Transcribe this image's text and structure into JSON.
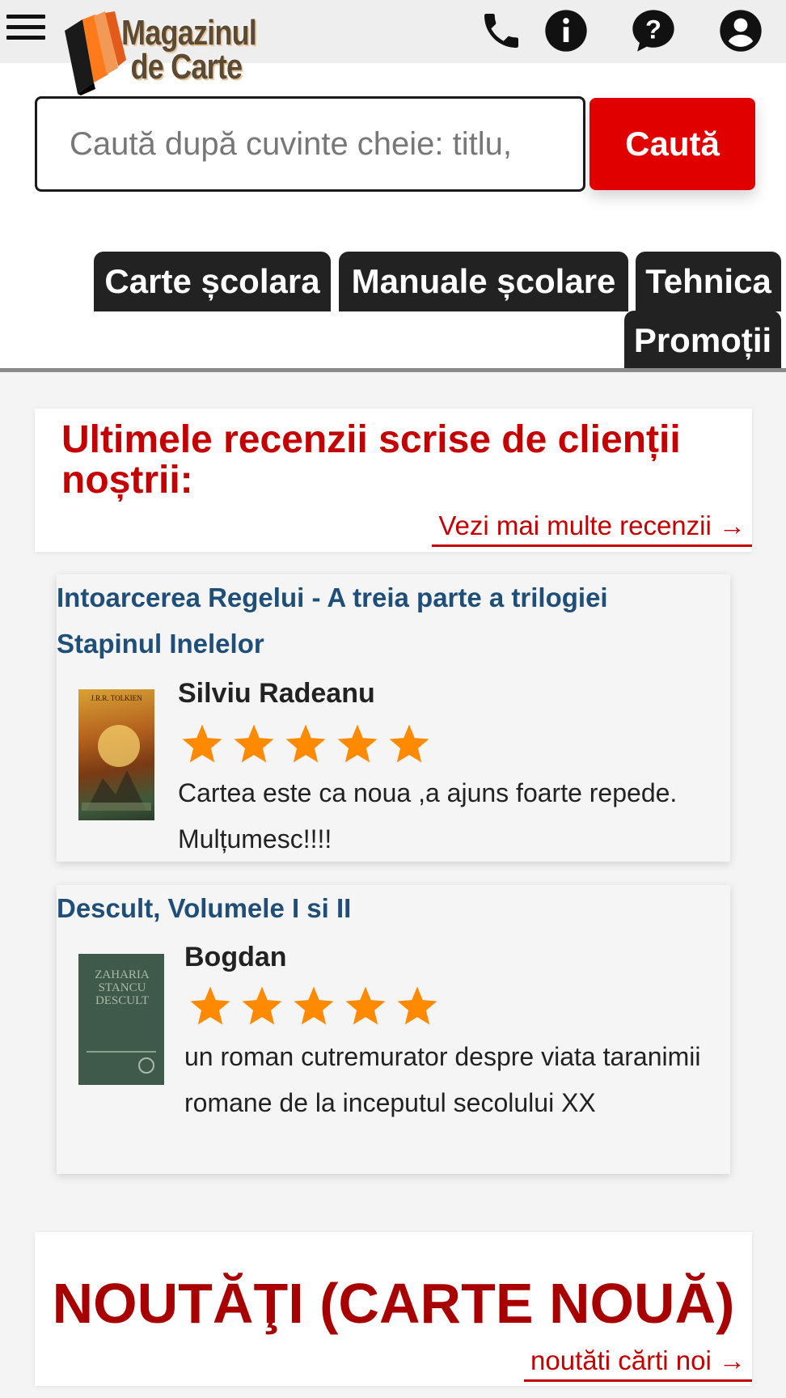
{
  "header": {
    "logo_line1": "Magazinul",
    "logo_line2": "de Carte",
    "icons": [
      "menu-icon",
      "phone-icon",
      "info-icon",
      "help-icon",
      "account-icon"
    ]
  },
  "search": {
    "placeholder": "Caută după cuvinte cheie: titlu,",
    "button_label": "Caută"
  },
  "categories": [
    {
      "label": "Carte școlara"
    },
    {
      "label": "Manuale școlare"
    },
    {
      "label": "Tehnica"
    },
    {
      "label": "Promoții"
    }
  ],
  "reviews": {
    "title": "Ultimele recenzii scrise de clienții noștrii:",
    "more_link": "Vezi mai multe recenzii →",
    "items": [
      {
        "book_title": "Intoarcerea Regelui - A treia parte a trilogiei Stapinul Inelelor",
        "cover_text": "J.R.R. TOLKIEN",
        "reviewer": "Silviu Radeanu",
        "rating": 5,
        "text": "Cartea este ca noua ,a ajuns foarte repede. Mulțumesc!!!!"
      },
      {
        "book_title": "Descult, Volumele I si II",
        "cover_text": "ZAHARIA STANCU DESCULT",
        "reviewer": "Bogdan",
        "rating": 5,
        "text": "un roman cutremurator despre viata taranimii romane de la inceputul secolului XX"
      }
    ]
  },
  "new_books": {
    "title": "NOUTĂŢI (CARTE NOUĂ)",
    "link": "noutăti cărti noi →"
  },
  "colors": {
    "accent_red": "#e00000",
    "title_red": "#c40000",
    "link_blue": "#1f4e79",
    "star_orange": "#ff8a00",
    "tab_dark": "#222222"
  }
}
